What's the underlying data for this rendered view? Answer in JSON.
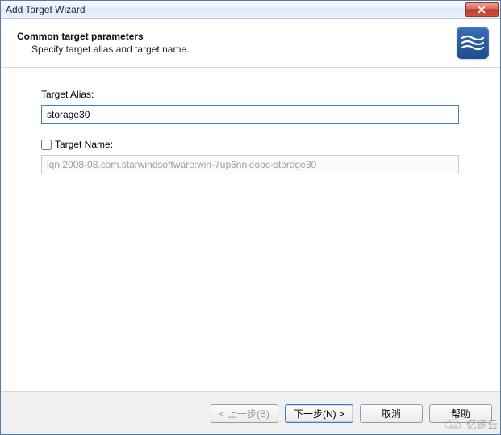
{
  "window": {
    "title": "Add Target Wizard"
  },
  "header": {
    "title": "Common target parameters",
    "subtitle": "Specify target alias and target name."
  },
  "fields": {
    "alias": {
      "label": "Target Alias:",
      "value": "storage30"
    },
    "name": {
      "label": "Target Name:",
      "checked": false,
      "value": "iqn.2008-08.com.starwindsoftware:win-7up6nnieobc-storage30"
    }
  },
  "buttons": {
    "back": "< 上一步(B)",
    "next": "下一步(N) >",
    "cancel": "取消",
    "help": "帮助"
  },
  "watermark": {
    "text": "亿速云"
  }
}
